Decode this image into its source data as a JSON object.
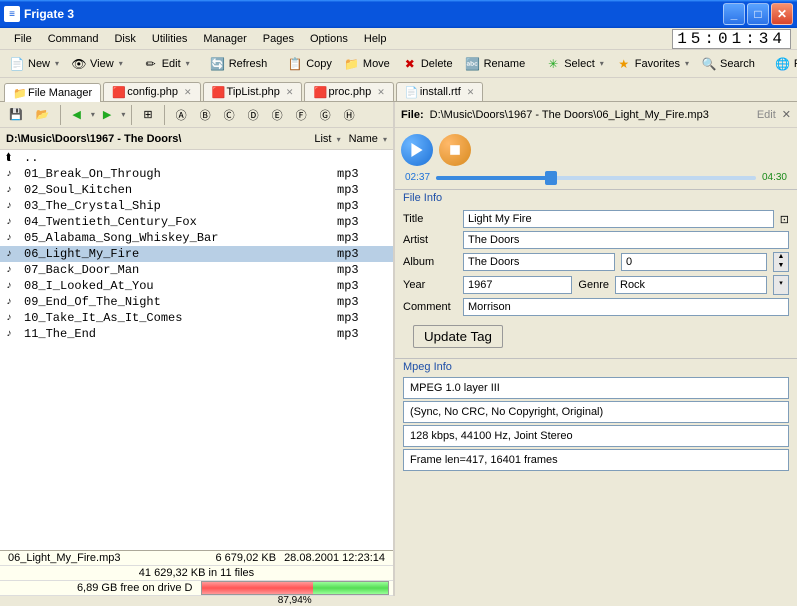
{
  "window": {
    "title": "Frigate 3"
  },
  "clock": "15:01:34",
  "menus": [
    "File",
    "Command",
    "Disk",
    "Utilities",
    "Manager",
    "Pages",
    "Options",
    "Help"
  ],
  "toolbar": [
    {
      "icon": "📄",
      "label": "New",
      "dd": true
    },
    {
      "icon": "👁",
      "label": "View",
      "dd": true
    },
    {
      "sep": true
    },
    {
      "icon": "✏",
      "label": "Edit",
      "dd": true
    },
    {
      "sep": true
    },
    {
      "icon": "🔄",
      "label": "Refresh"
    },
    {
      "sep": true
    },
    {
      "icon": "📋",
      "label": "Copy"
    },
    {
      "icon": "📁",
      "label": "Move"
    },
    {
      "icon": "✖",
      "label": "Delete",
      "iconColor": "#c00"
    },
    {
      "icon": "🔤",
      "label": "Rename"
    },
    {
      "sep": true
    },
    {
      "icon": "✳",
      "label": "Select",
      "dd": true,
      "iconColor": "#2a2"
    },
    {
      "icon": "★",
      "label": "Favorites",
      "dd": true,
      "iconColor": "#e90"
    },
    {
      "icon": "🔍",
      "label": "Search"
    },
    {
      "sep": true
    },
    {
      "icon": "🌐",
      "label": "FTP"
    }
  ],
  "tabs": [
    {
      "label": "File Manager",
      "icon": "📁",
      "active": true
    },
    {
      "label": "config.php",
      "icon": "🟥",
      "closable": true
    },
    {
      "label": "TipList.php",
      "icon": "🟥",
      "closable": true
    },
    {
      "label": "proc.php",
      "icon": "🟥",
      "closable": true
    },
    {
      "label": "install.rtf",
      "icon": "📄",
      "closable": true
    }
  ],
  "leftPanel": {
    "path": "D:\\Music\\Doors\\1967 - The Doors\\",
    "sort": {
      "list": "List",
      "name": "Name"
    },
    "updir": "..",
    "files": [
      {
        "name": "01_Break_On_Through",
        "ext": "mp3"
      },
      {
        "name": "02_Soul_Kitchen",
        "ext": "mp3"
      },
      {
        "name": "03_The_Crystal_Ship",
        "ext": "mp3"
      },
      {
        "name": "04_Twentieth_Century_Fox",
        "ext": "mp3"
      },
      {
        "name": "05_Alabama_Song_Whiskey_Bar",
        "ext": "mp3"
      },
      {
        "name": "06_Light_My_Fire",
        "ext": "mp3",
        "selected": true
      },
      {
        "name": "07_Back_Door_Man",
        "ext": "mp3"
      },
      {
        "name": "08_I_Looked_At_You",
        "ext": "mp3"
      },
      {
        "name": "09_End_Of_The_Night",
        "ext": "mp3"
      },
      {
        "name": "10_Take_It_As_It_Comes",
        "ext": "mp3"
      },
      {
        "name": "11_The_End",
        "ext": "mp3"
      }
    ],
    "status": {
      "selectedFile": "06_Light_My_Fire.mp3",
      "selectedSize": "6 679,02 KB",
      "selectedDate": "28.08.2001 12:23:14",
      "totalSummary": "41 629,32 KB in 11 files",
      "diskFree": "6,89 GB free on drive D",
      "diskPercent": "87,94%",
      "diskUsedPct": 60
    }
  },
  "rightPanel": {
    "headerLabel": "File:",
    "headerPath": "D:\\Music\\Doors\\1967 - The Doors\\06_Light_My_Fire.mp3",
    "editLabel": "Edit",
    "progress": {
      "start": "02:37",
      "end": "04:30",
      "pct": 36
    },
    "fileInfoLabel": "File Info",
    "fields": {
      "titleLabel": "Title",
      "title": "Light My Fire",
      "artistLabel": "Artist",
      "artist": "The Doors",
      "albumLabel": "Album",
      "album": "The Doors",
      "track": "0",
      "yearLabel": "Year",
      "year": "1967",
      "genreLabel": "Genre",
      "genre": "Rock",
      "commentLabel": "Comment",
      "comment": "Morrison"
    },
    "updateBtn": "Update Tag",
    "mpegLabel": "Mpeg Info",
    "mpeg": [
      "MPEG 1.0 layer III",
      "(Sync, No CRC, No Copyright, Original)",
      "128 kbps, 44100 Hz, Joint Stereo",
      "Frame len=417, 16401 frames"
    ]
  }
}
